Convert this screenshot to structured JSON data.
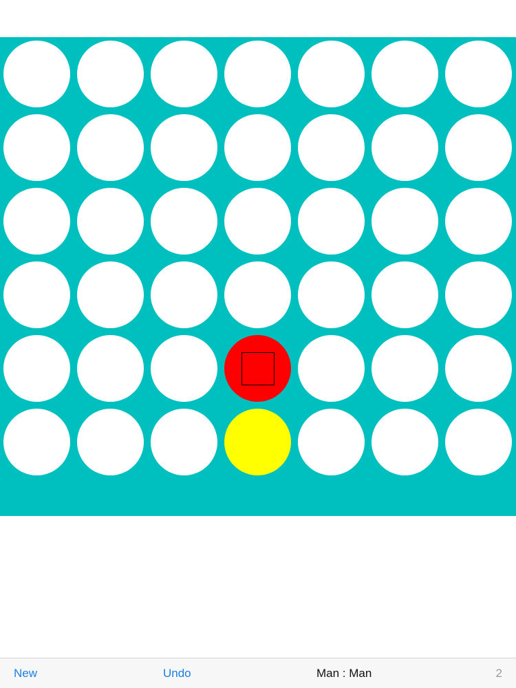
{
  "board": {
    "rows": 6,
    "columns": 7,
    "background_color": "#00bfbf",
    "empty_color": "#ffffff",
    "cells": [
      [
        "empty",
        "empty",
        "empty",
        "empty",
        "empty",
        "empty",
        "empty"
      ],
      [
        "empty",
        "empty",
        "empty",
        "empty",
        "empty",
        "empty",
        "empty"
      ],
      [
        "empty",
        "empty",
        "empty",
        "empty",
        "empty",
        "empty",
        "empty"
      ],
      [
        "empty",
        "empty",
        "empty",
        "empty",
        "empty",
        "empty",
        "empty"
      ],
      [
        "empty",
        "empty",
        "empty",
        "red",
        "empty",
        "empty",
        "empty"
      ],
      [
        "empty",
        "empty",
        "empty",
        "yellow",
        "empty",
        "empty",
        "empty"
      ]
    ],
    "last_move": {
      "row": 4,
      "column": 3
    }
  },
  "players": {
    "red_color": "#ff0000",
    "yellow_color": "#ffff00"
  },
  "toolbar": {
    "new_label": "New",
    "undo_label": "Undo",
    "mode_label": "Man : Man",
    "move_count": "2",
    "button_color": "#1a7fe0"
  }
}
